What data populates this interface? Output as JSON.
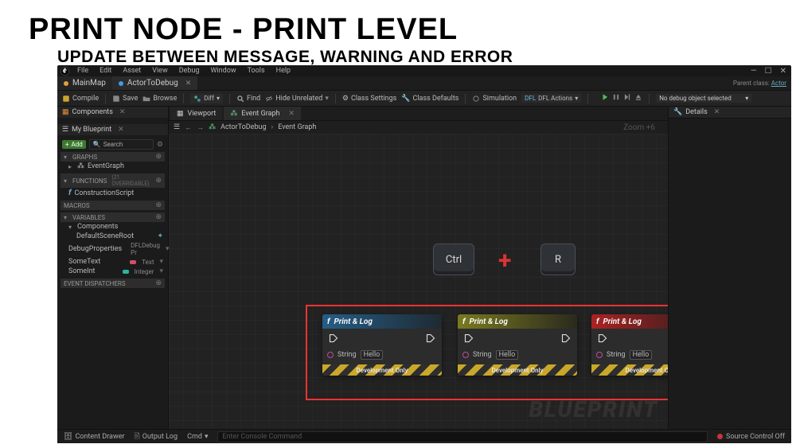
{
  "slide": {
    "title": "PRINT NODE - PRINT LEVEL",
    "subtitle": "UPDATE BETWEEN MESSAGE, WARNING AND ERROR"
  },
  "menu": {
    "file": "File",
    "edit": "Edit",
    "asset": "Asset",
    "view": "View",
    "debug": "Debug",
    "window": "Window",
    "tools": "Tools",
    "help": "Help"
  },
  "docs": {
    "map": "MainMap",
    "bp": "ActorToDebug"
  },
  "parentclass": {
    "label": "Parent class:",
    "value": "Actor"
  },
  "toolbar": {
    "compile": "Compile",
    "save": "Save",
    "browse": "Browse",
    "diff": "Diff",
    "find": "Find",
    "hideunrelated": "Hide Unrelated",
    "class_settings": "Class Settings",
    "class_defaults": "Class Defaults",
    "simulation": "Simulation",
    "dfl": "DFL Actions",
    "debug_dropdown": "No debug object selected"
  },
  "centerTabs": {
    "viewport": "Viewport",
    "eventgraph": "Event Graph"
  },
  "breadcrumb": {
    "a": "ActorToDebug",
    "b": "Event Graph"
  },
  "zoom": "Zoom +6",
  "leftTop": {
    "tab": "Components"
  },
  "mybp": {
    "tab": "My Blueprint",
    "add": "Add",
    "search_ph": "Search",
    "graphs": "GRAPHS",
    "eventgraph": "EventGraph",
    "functions": "FUNCTIONS",
    "fn_hint": "(21 OVERRIDABLE)",
    "constructscript": "ConstructionScript",
    "macros": "MACROS",
    "variables": "VARIABLES",
    "varComponents": "Components",
    "v1": "DefaultSceneRoot",
    "v2": "DebugProperties",
    "v2t": "DFLDebug Pr",
    "v3": "SomeText",
    "v3t": "Text",
    "v4": "SomeInt",
    "v4t": "Integer",
    "dispatchers": "EVENT DISPATCHERS"
  },
  "details": {
    "tab": "Details"
  },
  "keys": {
    "ctrl": "Ctrl",
    "r": "R"
  },
  "node": {
    "title": "Print & Log",
    "pin_label": "String",
    "pin_value": "Hello",
    "footer": "Development Only",
    "levels": [
      "message",
      "warning",
      "error"
    ]
  },
  "watermark": "BLUEPRINT",
  "status": {
    "drawer": "Content Drawer",
    "output": "Output Log",
    "cmd_label": "Cmd",
    "cmd_ph": "Enter Console Command",
    "sc": "Source Control Off"
  }
}
